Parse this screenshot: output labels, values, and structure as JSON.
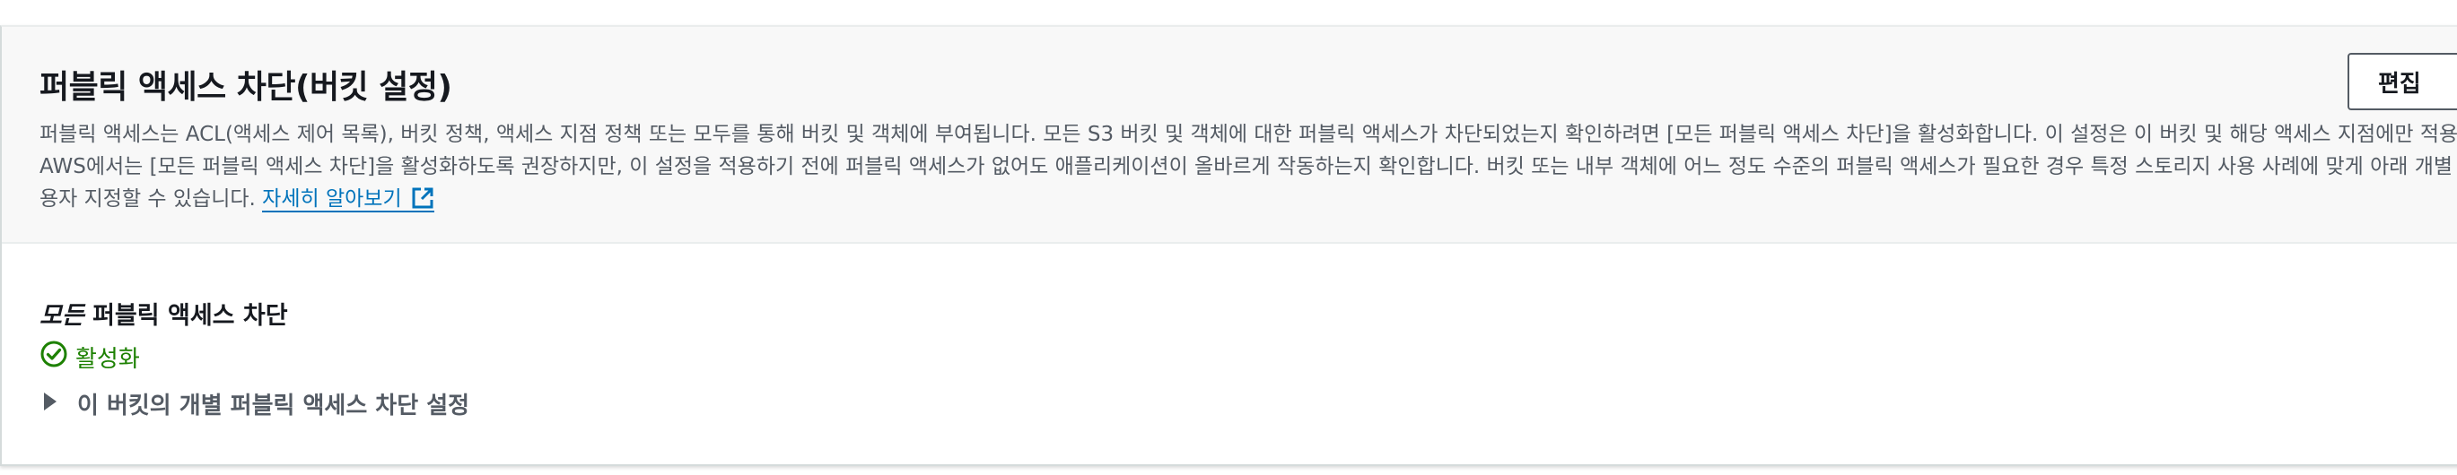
{
  "section": {
    "title": "퍼블릭 액세스 차단(버킷 설정)",
    "edit_label": "편집",
    "description_line1": "퍼블릭 액세스는 ACL(액세스 제어 목록), 버킷 정책, 액세스 지점 정책 또는 모두를 통해 버킷 및 객체에 부여됩니다. 모든 S3 버킷 및 객체에 대한 퍼블릭 액세스가 차단되었는지 확인하려면 [모든 퍼블릭 액세스 차단]을 활성화합니다. 이 설정은 이 버킷 및 해당 액세스 지점에만 적용됩니다.",
    "description_line2": "AWS에서는 [모든 퍼블릭 액세스 차단]을 활성화하도록 권장하지만, 이 설정을 적용하기 전에 퍼블릭 액세스가 없어도 애플리케이션이 올바르게 작동하는지 확인합니다. 버킷 또는 내부 객체에 어느 정도 수준의 퍼블릭 액세스가 필요한 경우 특정 스토리지 사용 사례에 맞게 아래 개별 설정을 사",
    "description_line3": "용자 지정할 수 있습니다.",
    "learn_more": "자세히 알아보기"
  },
  "block_all": {
    "label_em": "모든",
    "label_rest": " 퍼블릭 액세스 차단",
    "status": "활성화",
    "status_color": "#1d8102"
  },
  "individual_settings": {
    "label": "이 버킷의 개별 퍼블릭 액세스 차단 설정",
    "icon": "caret-right-icon"
  },
  "colors": {
    "link": "#0073bb",
    "success": "#1d8102",
    "header_bg": "#f8f8f8"
  }
}
